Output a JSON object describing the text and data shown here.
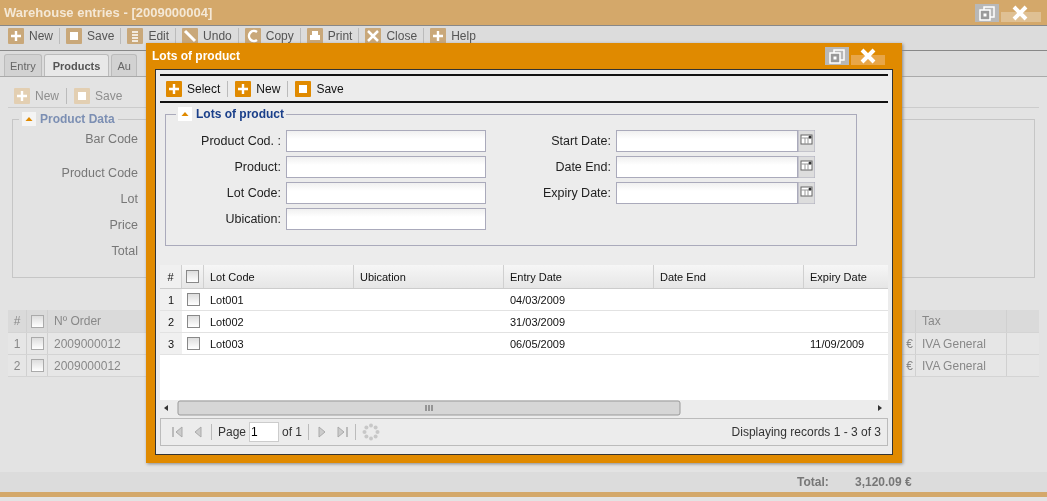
{
  "window": {
    "title": "Warehouse entries - [2009000004]"
  },
  "toolbar": [
    {
      "label": "New"
    },
    {
      "label": "Save"
    },
    {
      "label": "Edit"
    },
    {
      "label": "Undo"
    },
    {
      "label": "Copy"
    },
    {
      "label": "Print"
    },
    {
      "label": "Close"
    },
    {
      "label": "Help"
    }
  ],
  "tabs": [
    {
      "label": "Entry",
      "selected": false
    },
    {
      "label": "Products",
      "selected": true
    },
    {
      "label": "Au",
      "selected": false
    }
  ],
  "sub_toolbar": [
    {
      "label": "New",
      "disabled": true
    },
    {
      "label": "Save",
      "disabled": true
    }
  ],
  "product_data": {
    "title": "Product Data",
    "labels": [
      "Bar Code",
      "Product Code",
      "Lot",
      "Price",
      "Total"
    ]
  },
  "grid": {
    "columns": {
      "number": "#",
      "order": "Nº Order",
      "tax": "Tax"
    },
    "header_checked": false,
    "rows": [
      {
        "index": "1",
        "checked": false,
        "order": "2009000012",
        "amount": "€",
        "tax": "IVA General"
      },
      {
        "index": "2",
        "checked": false,
        "order": "2009000012",
        "amount": "€",
        "tax": "IVA General"
      }
    ]
  },
  "footer": {
    "label": "Total:",
    "value": "3,120.09 €"
  },
  "dialog": {
    "title": "Lots of product",
    "toolbar": [
      {
        "label": "Select"
      },
      {
        "label": "New"
      },
      {
        "label": "Save"
      }
    ],
    "fieldset": {
      "title": "Lots of product",
      "left_fields": [
        {
          "label": "Product Cod. :"
        },
        {
          "label": "Product:"
        },
        {
          "label": "Lot Code:"
        },
        {
          "label": "Ubication:"
        }
      ],
      "right_fields": [
        {
          "label": "Start Date:"
        },
        {
          "label": "Date End:"
        },
        {
          "label": "Expiry Date:"
        }
      ]
    },
    "grid": {
      "columns": [
        "#",
        "Lot Code",
        "Ubication",
        "Entry Date",
        "Date End",
        "Expiry Date"
      ],
      "header_checked": false,
      "rows": [
        {
          "index": "1",
          "checked": false,
          "lot_code": "Lot001",
          "entry_date": "04/03/2009"
        },
        {
          "index": "2",
          "checked": false,
          "lot_code": "Lot002",
          "entry_date": "31/03/2009"
        },
        {
          "index": "3",
          "checked": false,
          "lot_code": "Lot003",
          "entry_date": "06/05/2009",
          "expiry_date": "11/09/2009"
        }
      ]
    },
    "paging": {
      "page_label": "Page",
      "page": "1",
      "of": "of 1",
      "status": "Displaying records 1 - 3 of 3"
    }
  }
}
